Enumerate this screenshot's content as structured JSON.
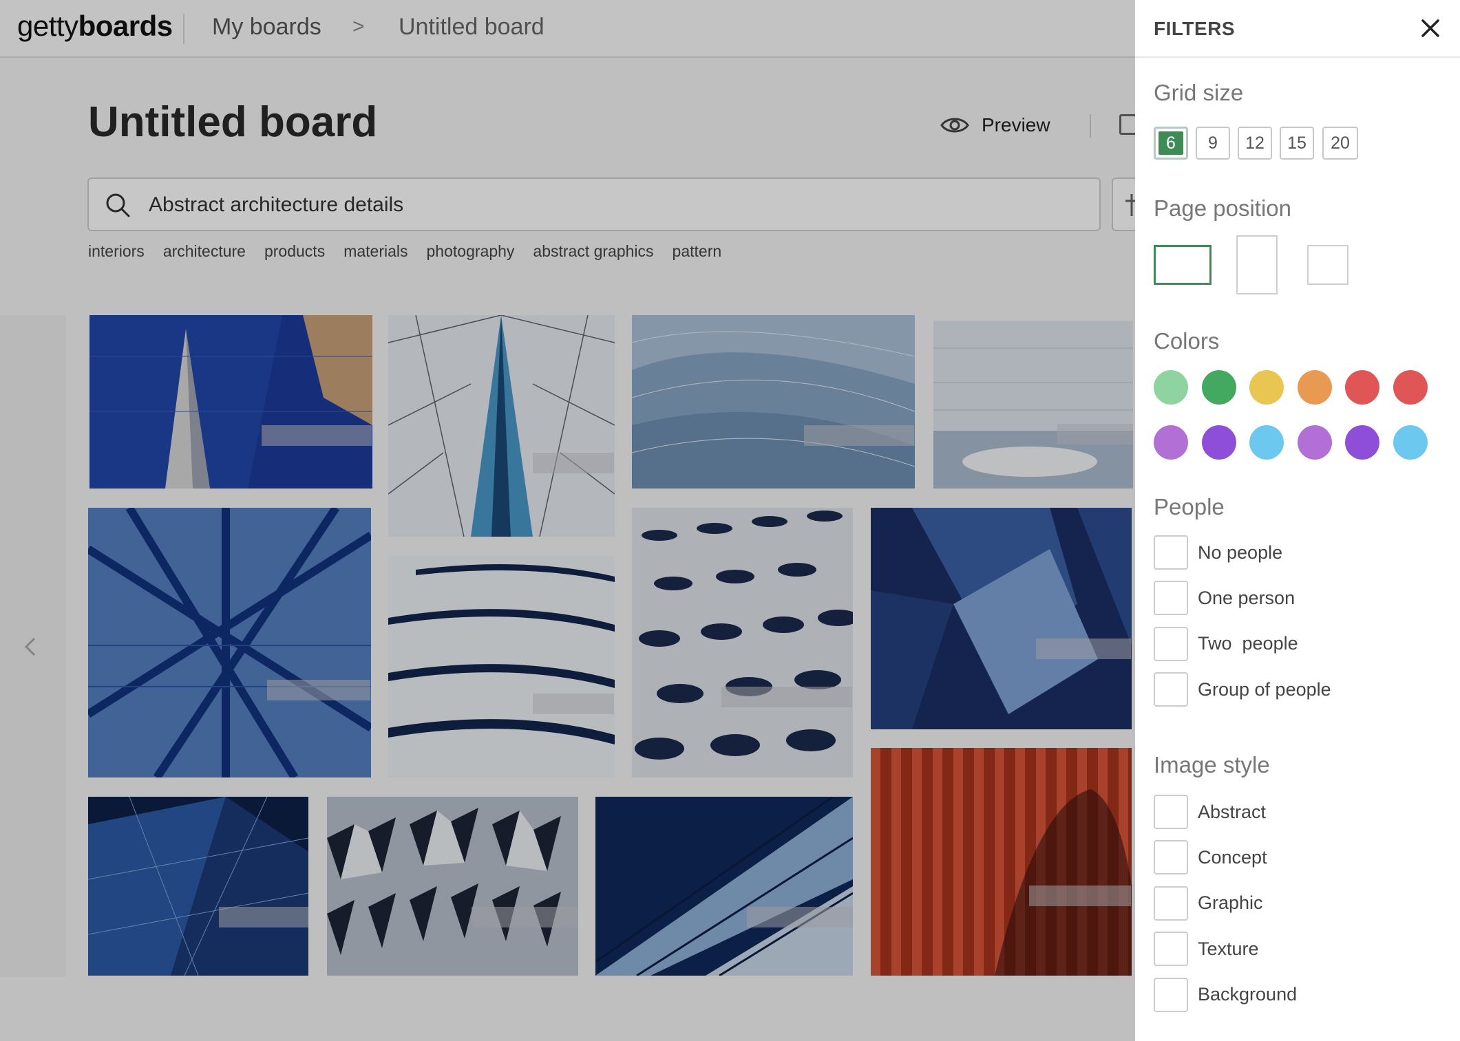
{
  "header": {
    "logo_light": "getty",
    "logo_bold": "boards",
    "breadcrumb_root": "My boards",
    "breadcrumb_sep": ">",
    "breadcrumb_current": "Untitled board"
  },
  "board": {
    "title": "Untitled board",
    "preview_label": "Preview"
  },
  "search": {
    "value": "Abstract architecture details",
    "tags": [
      "interiors",
      "architecture",
      "products",
      "materials",
      "photography",
      "abstract graphics",
      "pattern"
    ]
  },
  "images": [
    {
      "name": "image-tile-blue-spire"
    },
    {
      "name": "image-tile-glass-tower-perspective"
    },
    {
      "name": "image-tile-wave-glass-roof"
    },
    {
      "name": "image-tile-skylight-ceiling"
    },
    {
      "name": "image-tile-steel-lattice"
    },
    {
      "name": "image-tile-white-wave-facade"
    },
    {
      "name": "image-tile-perforated-facade"
    },
    {
      "name": "image-tile-blue-glass-angles"
    },
    {
      "name": "image-tile-dark-glass-triangles"
    },
    {
      "name": "image-tile-silver-panels"
    },
    {
      "name": "image-tile-glass-diagonal"
    },
    {
      "name": "image-tile-red-louvres"
    }
  ],
  "filters": {
    "title": "FILTERS",
    "grid_size": {
      "title": "Grid size",
      "options": [
        "6",
        "9",
        "12",
        "15",
        "20"
      ],
      "selected": "6"
    },
    "page_position": {
      "title": "Page position",
      "options": [
        "landscape",
        "portrait",
        "square"
      ],
      "selected": "landscape"
    },
    "colors": {
      "title": "Colors",
      "swatches": [
        "#8fd3a0",
        "#43a960",
        "#e8c651",
        "#e99a52",
        "#e05656",
        "#e05656",
        "#b26fd6",
        "#8e4ed8",
        "#6cc8ee",
        "#b26fd6",
        "#8e4ed8",
        "#6cc8ee"
      ]
    },
    "people": {
      "title": "People",
      "options": [
        "No people",
        "One person",
        "Two  people",
        "Group of people"
      ]
    },
    "image_style": {
      "title": "Image style",
      "options": [
        "Abstract",
        "Concept",
        "Graphic",
        "Texture",
        "Background"
      ]
    }
  },
  "colors": {
    "accent": "#3d8b57"
  }
}
